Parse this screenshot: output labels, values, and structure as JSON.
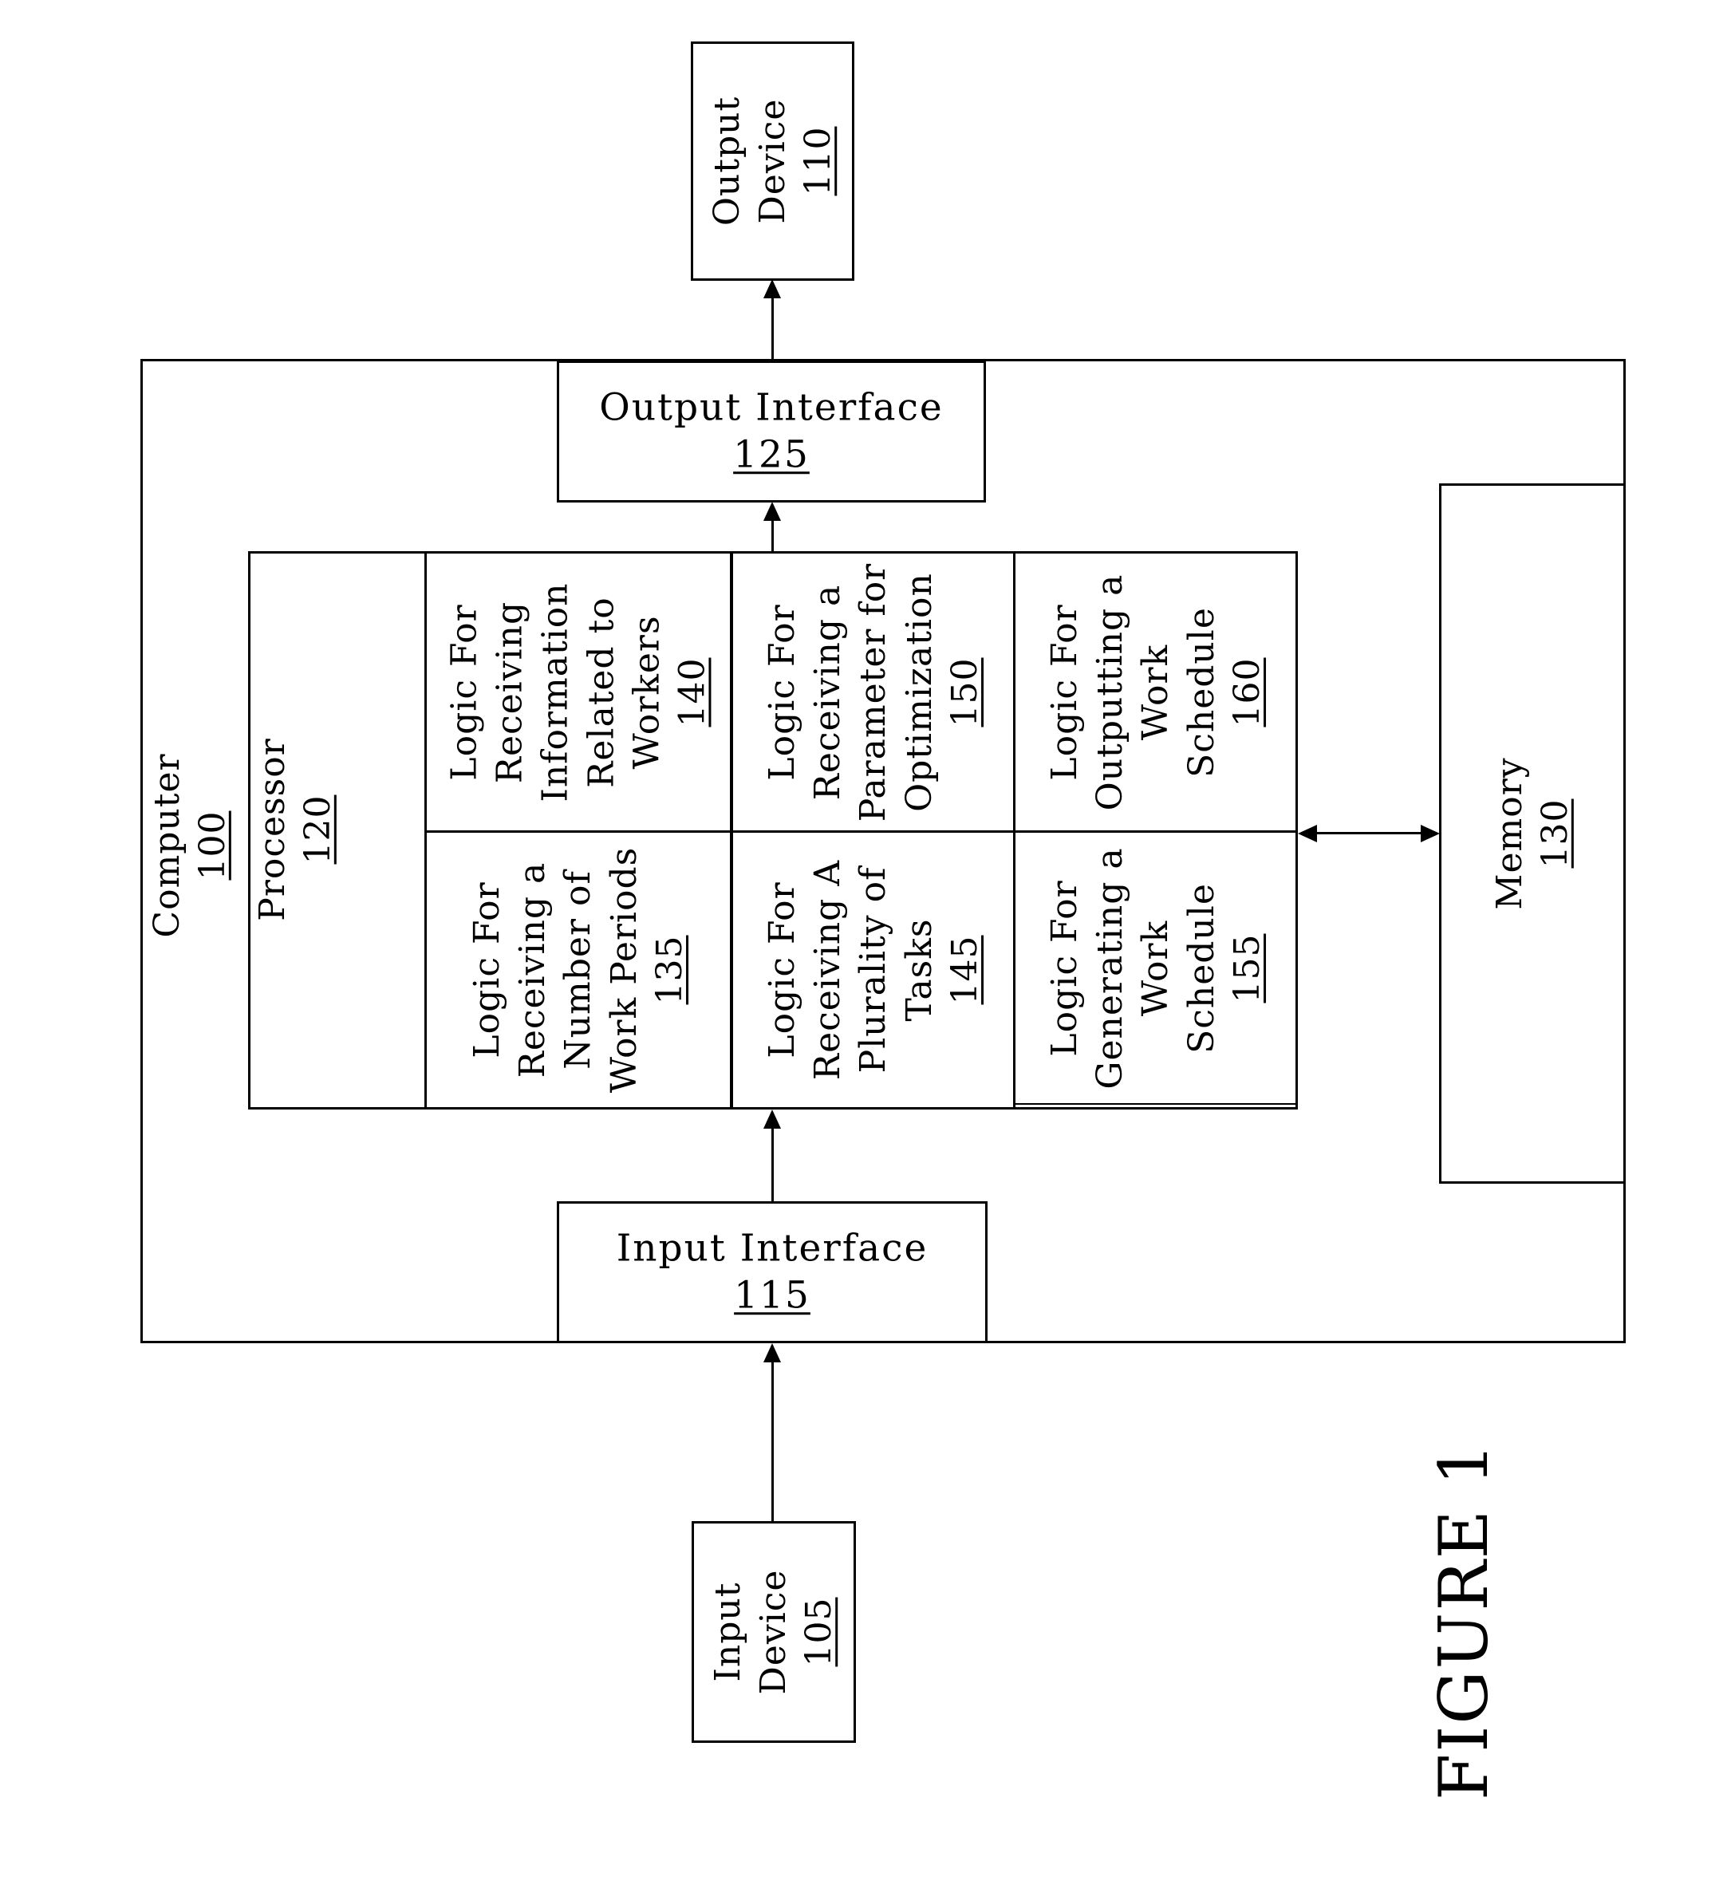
{
  "figure": {
    "caption": "FIGURE 1",
    "blocks": {
      "output_device": {
        "lines": [
          "Output",
          "Device"
        ],
        "ref": "110"
      },
      "input_device": {
        "lines": [
          "Input",
          "Device"
        ],
        "ref": "105"
      },
      "computer": {
        "lines": [
          "Computer"
        ],
        "ref": "100"
      },
      "processor": {
        "lines": [
          "Processor"
        ],
        "ref": "120"
      },
      "output_interface": {
        "lines": [
          "Output Interface"
        ],
        "ref": "125"
      },
      "input_interface": {
        "lines": [
          "Input Interface"
        ],
        "ref": "115"
      },
      "memory": {
        "lines": [
          "Memory"
        ],
        "ref": "130"
      },
      "logic_140": {
        "lines": [
          "Logic For",
          "Receiving",
          "Information",
          "Related to",
          "Workers"
        ],
        "ref": "140"
      },
      "logic_150": {
        "lines": [
          "Logic For",
          "Receiving a",
          "Parameter for",
          "Optimization"
        ],
        "ref": "150"
      },
      "logic_160": {
        "lines": [
          "Logic For",
          "Outputting a",
          "Work",
          "Schedule"
        ],
        "ref": "160"
      },
      "logic_135": {
        "lines": [
          "Logic For",
          "Receiving a",
          "Number of",
          "Work Periods"
        ],
        "ref": "135"
      },
      "logic_145": {
        "lines": [
          "Logic For",
          "Receiving A",
          "Plurality of",
          "Tasks"
        ],
        "ref": "145"
      },
      "logic_155": {
        "lines": [
          "Logic For",
          "Generating a",
          "Work",
          "Schedule"
        ],
        "ref": "155"
      }
    },
    "connections": [
      {
        "from": "input_device",
        "to": "input_interface",
        "type": "arrow"
      },
      {
        "from": "input_interface",
        "to": "processor",
        "type": "arrow"
      },
      {
        "from": "processor",
        "to": "output_interface",
        "type": "arrow"
      },
      {
        "from": "output_interface",
        "to": "output_device",
        "type": "arrow"
      },
      {
        "from": "processor",
        "to": "memory",
        "type": "bidirectional-arrow"
      }
    ]
  }
}
